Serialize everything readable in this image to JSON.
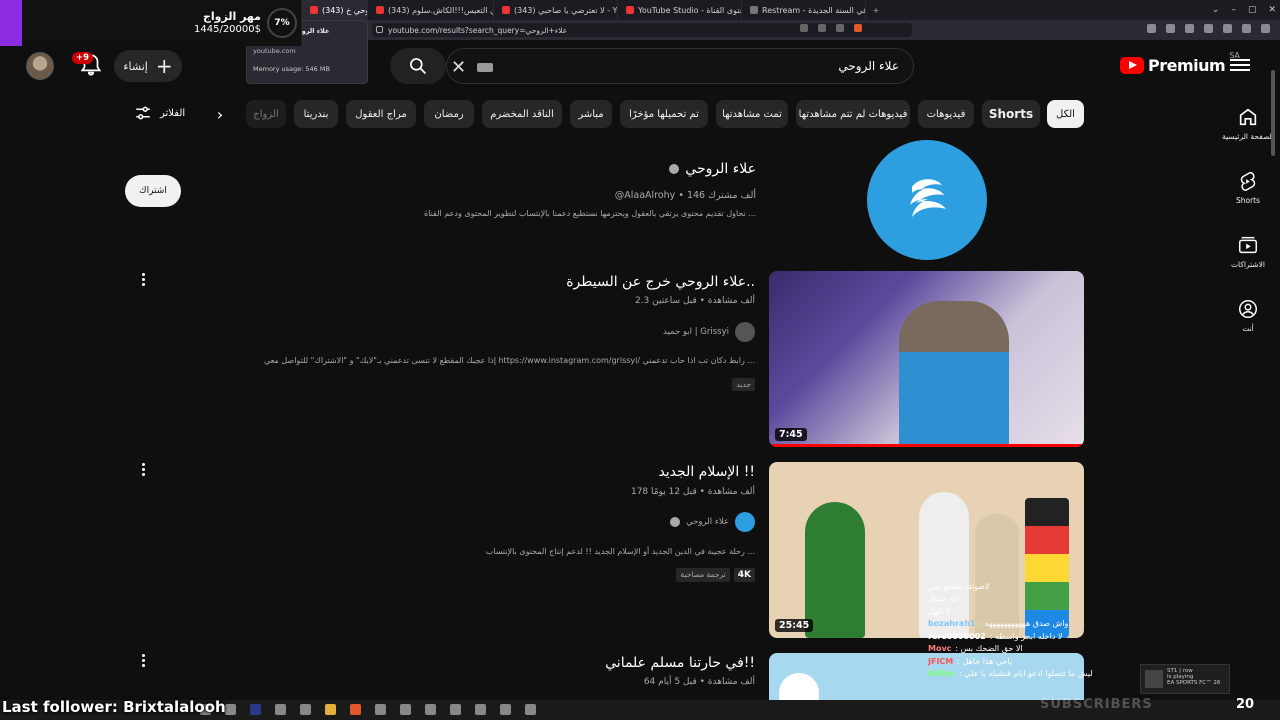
{
  "browser": {
    "tabs": [
      {
        "label": "(343) علاء الروحي خ"
      },
      {
        "label": "(343) علاء الروحي خرج عن السيطرة"
      },
      {
        "label": "(343) الأربعيني التعيس!!!الكاش.سلوم"
      },
      {
        "label": "(343) لا تعترضي يا صاحبي - YouTube"
      },
      {
        "label": "YouTube Studio - محتوى القناة"
      },
      {
        "label": "Restream - اول بث في السنة الجديدة"
      }
    ],
    "url": "youtube.com/results?search_query=علاء+الروحي",
    "popup": {
      "title": "(343) علاء الروحي خرج",
      "domain": "youtube.com",
      "memory": "Memory usage: 546 MB"
    }
  },
  "goal": {
    "title": "مهر الزواج",
    "amount": "1445/20000$",
    "percent": "7%"
  },
  "header": {
    "notifications_badge": "+9",
    "create_label": "إنشاء",
    "search_query": "علاء الروحي",
    "logo_text": "Premium",
    "logo_region": "SA"
  },
  "filters": {
    "label": "الفلاتر",
    "chips": [
      "الكل",
      "Shorts",
      "فيديوهات",
      "فيديوهات لم تتم مشاهدتها",
      "تمت مشاهدتها",
      "تم تحميلها مؤخرًا",
      "مباشر",
      "الناقد المخضرم",
      "رمضان",
      "مراج العقول",
      "بندريتا",
      "الزواج"
    ]
  },
  "nav": [
    {
      "label": "الصفحة الرئيسية",
      "icon": "home-icon"
    },
    {
      "label": "Shorts",
      "icon": "shorts-icon"
    },
    {
      "label": "الاشتراكات",
      "icon": "subscriptions-icon"
    },
    {
      "label": "أنت",
      "icon": "you-icon"
    }
  ],
  "channel": {
    "name": "علاء الروحي",
    "meta": "@AlaaAlrohy • 146 ألف مشترك",
    "description": "نحاول تقديم محتوى يرتقي بالعقول ويحترمها نستطيع دعمنا بالإنتساب لتطوير المحتوى ودعم القناة ...",
    "subscribe_label": "اشتراك"
  },
  "videos": [
    {
      "title": "علاء الروحي خرج عن السيطرة..",
      "meta": "2.3 ألف مشاهدة • قبل ساعتين",
      "channel": "ابو حميد | Grissyi",
      "description": "إذا عجبك المقطع لا تنسى تدعمني بـ\"لايك\" و \"الاشتراك\" للتواصل معي https://www.instagram.com/grissyi/ رابط دكان تب اذا حاب تدعمني ...",
      "badges": [
        "جديد"
      ],
      "duration": "7:45"
    },
    {
      "title": "الإسلام الجديد !!",
      "meta": "178 ألف مشاهدة • قبل 12 يومًا",
      "channel": "علاء الروحي",
      "description": "رحلة عجيبة في الدين الجديد أو الإسلام الجديد !! لدعم إنتاج المحتوى بالإنتساب ...",
      "badges": [
        "4K",
        "ترجمة مصاحبة"
      ],
      "duration": "25:45"
    },
    {
      "title": "في حارتنا مسلم علماني!!",
      "meta": "64 ألف مشاهدة • قبل 5 أيام",
      "channel": "",
      "description": "",
      "badges": [],
      "duration": ""
    }
  ],
  "chat": [
    {
      "user": "",
      "msg": "لاصوتك يتقطع بس"
    },
    {
      "user": "",
      "msg": "ايه جدول"
    },
    {
      "user": "",
      "msg": "لا الهل"
    },
    {
      "user": "bozahrah1",
      "msg": ": واش صدق هههههههههههه"
    },
    {
      "user": "rere0000002",
      "msg": ": لا داخله ابحر واسطه"
    },
    {
      "user": "Movc",
      "msg": ": الا حق الضحك بس"
    },
    {
      "user": "JFICM",
      "msg": ": ياخي هذا جاهل"
    },
    {
      "user": "h89bc",
      "msg": ": ليش ما تتصلوا ادعو ايام قتشيله يا علي"
    }
  ],
  "stream": {
    "line1": "ST1 | row",
    "line2": "Is playing",
    "line3": "EA SPORTS FC™ 26"
  },
  "overlay": {
    "last_follower": "Last follower: Brixtalalooh",
    "subscribers": "SUBSCRIBERS",
    "clock": "20"
  }
}
